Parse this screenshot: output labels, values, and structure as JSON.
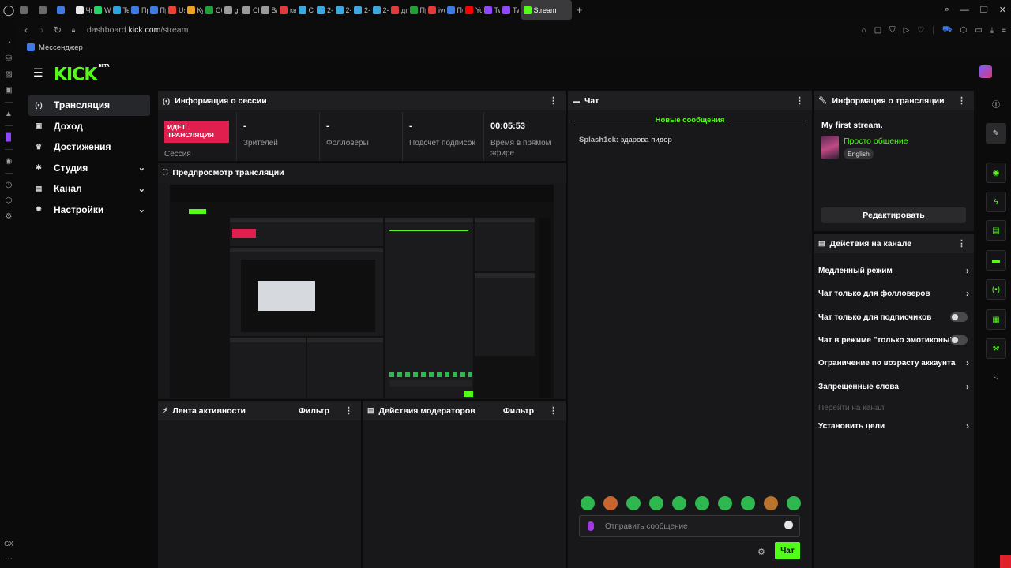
{
  "browser": {
    "tabs": [
      {
        "label": "",
        "color": "#6a6a6a"
      },
      {
        "label": "",
        "color": "#6a6a6a"
      },
      {
        "label": "",
        "color": "#3d7ae6"
      },
      {
        "label": "Чи",
        "color": "#e8e8e8"
      },
      {
        "label": "Wh",
        "color": "#25d366"
      },
      {
        "label": "Tel",
        "color": "#2aa3e0"
      },
      {
        "label": "Пр",
        "color": "#3d7ae6"
      },
      {
        "label": "Пр",
        "color": "#3d7ae6"
      },
      {
        "label": "Use",
        "color": "#ea4335"
      },
      {
        "label": "Кур",
        "color": "#f0a020"
      },
      {
        "label": "Сбе",
        "color": "#21a038"
      },
      {
        "label": "gro",
        "color": "#9a9a9a"
      },
      {
        "label": "Ch",
        "color": "#9a9a9a"
      },
      {
        "label": "Ваш",
        "color": "#9a9a9a"
      },
      {
        "label": "ква",
        "color": "#e03a3a"
      },
      {
        "label": "Сн",
        "color": "#3da8e0"
      },
      {
        "label": "2-к",
        "color": "#3da8e0"
      },
      {
        "label": "2-к",
        "color": "#3da8e0"
      },
      {
        "label": "2-к",
        "color": "#3da8e0"
      },
      {
        "label": "2-к",
        "color": "#3da8e0"
      },
      {
        "label": "дгт",
        "color": "#e03a3a"
      },
      {
        "label": "Пр",
        "color": "#21a038"
      },
      {
        "label": "ivc",
        "color": "#e03a3a"
      },
      {
        "label": "По",
        "color": "#3d7ae6"
      },
      {
        "label": "You",
        "color": "#ff0000"
      },
      {
        "label": "Twi",
        "color": "#9146ff"
      },
      {
        "label": "Twi",
        "color": "#9146ff"
      }
    ],
    "active_tab": {
      "label": "Stream",
      "color": "#53fc18"
    },
    "url_prefix": "dashboard.",
    "url_host": "kick.com",
    "url_path": "/stream",
    "bookmark": "Мессенджер"
  },
  "kick": {
    "logo": "KICK",
    "logo_badge": "BETA",
    "nav": [
      {
        "label": "Трансляция",
        "icon": "broadcast-icon",
        "glyph": "(•)",
        "active": true,
        "chevron": false
      },
      {
        "label": "Доход",
        "icon": "income-icon",
        "glyph": "▣",
        "active": false,
        "chevron": false
      },
      {
        "label": "Достижения",
        "icon": "trophy-icon",
        "glyph": "♛",
        "active": false,
        "chevron": false
      },
      {
        "label": "Студия",
        "icon": "studio-icon",
        "glyph": "✱",
        "active": false,
        "chevron": true
      },
      {
        "label": "Канал",
        "icon": "channel-icon",
        "glyph": "▤",
        "active": false,
        "chevron": true
      },
      {
        "label": "Настройки",
        "icon": "settings-icon",
        "glyph": "✹",
        "active": false,
        "chevron": true
      }
    ],
    "session": {
      "title": "Информация о сессии",
      "live_badge": "ИДЕТ ТРАНСЛЯЦИЯ",
      "session_label": "Сессия",
      "stats": [
        {
          "value": "-",
          "label": "Зрителей"
        },
        {
          "value": "-",
          "label": "Фолловеры"
        },
        {
          "value": "-",
          "label": "Подсчет подписок"
        },
        {
          "value": "00:05:53",
          "label": "Время в прямом эфире"
        }
      ]
    },
    "preview": {
      "title": "Предпросмотр трансляции"
    },
    "activity": {
      "title": "Лента активности",
      "filter": "Фильтр"
    },
    "modactions": {
      "title": "Действия модераторов",
      "filter": "Фильтр"
    },
    "chat": {
      "title": "Чат",
      "new_messages": "Новые сообщения",
      "messages": [
        {
          "user": "Splash1ck:",
          "text": "здарова пидор"
        }
      ],
      "placeholder": "Отправить сообщение",
      "send_label": "Чат"
    },
    "stream_info": {
      "title": "Информация о трансляции",
      "stream_title": "My first stream.",
      "category": "Просто общение",
      "language": "English",
      "edit_label": "Редактировать"
    },
    "channel_actions": {
      "title": "Действия на канале",
      "items": [
        {
          "label": "Медленный режим",
          "control": "arrow"
        },
        {
          "label": "Чат только для фолловеров",
          "control": "arrow"
        },
        {
          "label": "Чат только для подписчиков",
          "control": "toggle",
          "on": false
        },
        {
          "label": "Чат в режиме \"только эмотиконы\"",
          "control": "toggle",
          "on": false
        },
        {
          "label": "Ограничение по возрасту аккаунта",
          "control": "arrow"
        },
        {
          "label": "Запрещенные слова",
          "control": "arrow"
        },
        {
          "label": "Перейти на канал",
          "control": "none",
          "disabled": true
        },
        {
          "label": "Установить цели",
          "control": "arrow"
        }
      ]
    },
    "accent": "#53fc18",
    "live_color": "#e01f4f"
  }
}
